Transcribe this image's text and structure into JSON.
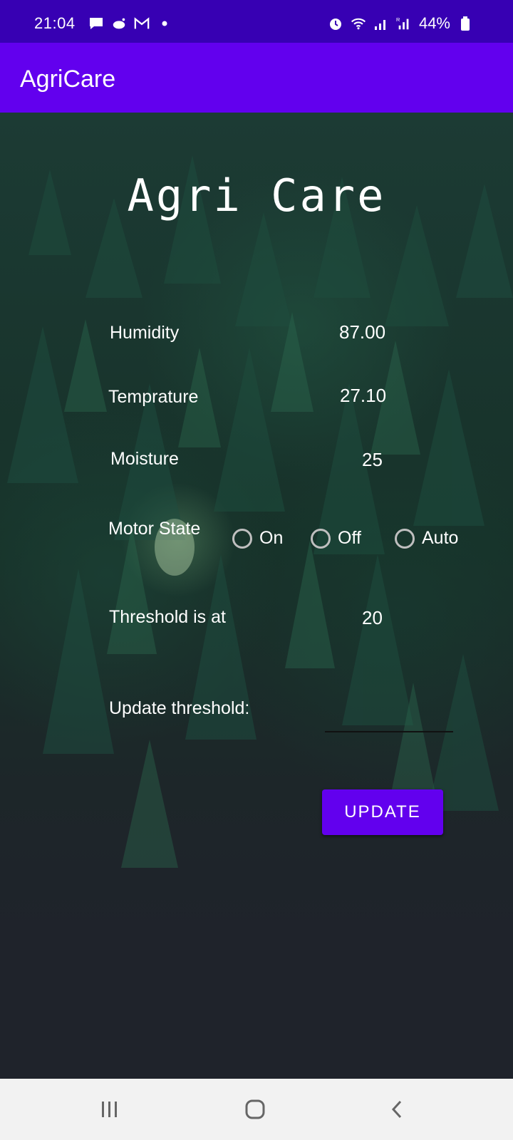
{
  "status_bar": {
    "time": "21:04",
    "battery": "44%",
    "icons_left": [
      "message-icon",
      "reddit-icon",
      "gmail-icon",
      "dot-icon"
    ],
    "icons_right": [
      "alarm-icon",
      "wifi-icon",
      "signal-icon",
      "signal-r-icon",
      "battery-icon"
    ]
  },
  "app_bar": {
    "title": "AgriCare"
  },
  "main": {
    "headline": "Agri Care",
    "humidity_label": "Humidity",
    "humidity_value": "87.00",
    "temperature_label": "Temprature",
    "temperature_value": "27.10",
    "moisture_label": "Moisture",
    "moisture_value": "25",
    "motor_label": "Motor State",
    "motor_options": [
      "On",
      "Off",
      "Auto"
    ],
    "threshold_label": "Threshold is at",
    "threshold_value": "20",
    "update_label": "Update threshold:",
    "update_input_value": "",
    "update_button": "UPDATE"
  },
  "nav_bar": {
    "items": [
      "recent-apps-icon",
      "home-icon",
      "back-icon"
    ]
  },
  "colors": {
    "status_bg": "#3700b3",
    "primary": "#6200ee"
  }
}
